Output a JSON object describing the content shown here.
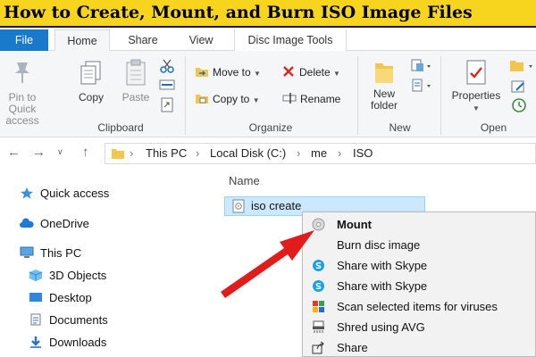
{
  "banner": {
    "title": "How to Create, Mount, and Burn ISO Image Files"
  },
  "tabs": {
    "file": "File",
    "home": "Home",
    "share": "Share",
    "view": "View",
    "disc_tools": "Disc Image Tools"
  },
  "ribbon": {
    "clipboard": {
      "pin": "Pin to Quick access",
      "copy": "Copy",
      "paste": "Paste",
      "label": "Clipboard"
    },
    "organize": {
      "move_to": "Move to",
      "copy_to": "Copy to",
      "delete": "Delete",
      "rename": "Rename",
      "label": "Organize"
    },
    "new": {
      "new_folder": "New folder",
      "label": "New"
    },
    "open": {
      "properties": "Properties",
      "label": "Open"
    }
  },
  "address": {
    "path": [
      "This PC",
      "Local Disk (C:)",
      "me",
      "ISO"
    ]
  },
  "nav_pane": {
    "items": [
      {
        "label": "Quick access",
        "icon": "star-icon"
      },
      {
        "label": "OneDrive",
        "icon": "cloud-icon"
      },
      {
        "label": "This PC",
        "icon": "monitor-icon"
      },
      {
        "label": "3D Objects",
        "icon": "cube-icon"
      },
      {
        "label": "Desktop",
        "icon": "desktop-icon"
      },
      {
        "label": "Documents",
        "icon": "documents-icon"
      },
      {
        "label": "Downloads",
        "icon": "downloads-icon"
      }
    ]
  },
  "content": {
    "column_header": "Name",
    "file_name": "iso create"
  },
  "context_menu": {
    "items": [
      {
        "label": "Mount",
        "icon": "disc-icon"
      },
      {
        "label": "Burn disc image",
        "icon": ""
      },
      {
        "label": "Share with Skype",
        "icon": "skype-icon"
      },
      {
        "label": "Share with Skype",
        "icon": "skype-icon"
      },
      {
        "label": "Scan selected items for viruses",
        "icon": "antivirus-icon"
      },
      {
        "label": "Shred using AVG",
        "icon": "shredder-icon"
      },
      {
        "label": "Share",
        "icon": "share-icon"
      }
    ]
  },
  "colors": {
    "banner": "#f7d51e",
    "file_tab": "#1979ca",
    "selection": "#cce8ff",
    "arrow": "#e21b1b"
  }
}
